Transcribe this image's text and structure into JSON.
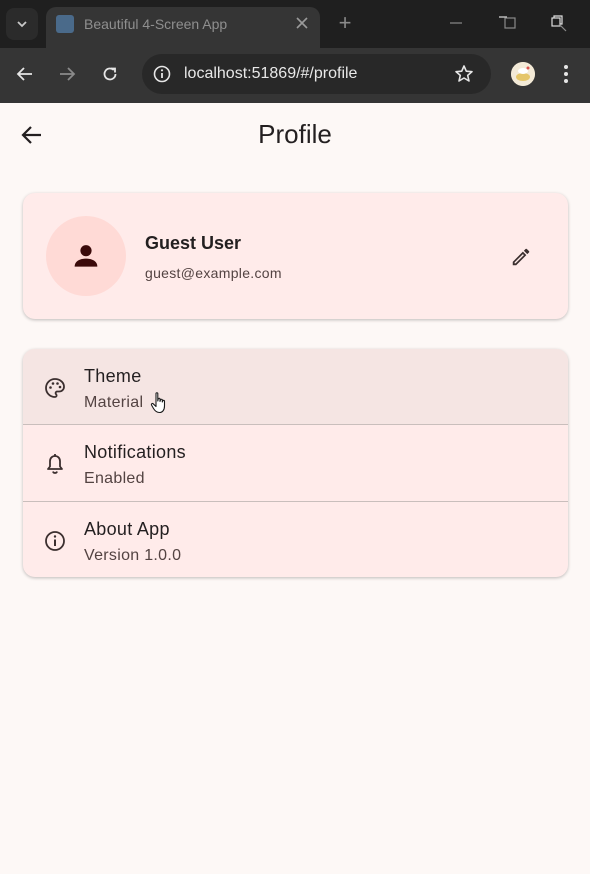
{
  "browser": {
    "tab_title": "Beautiful 4-Screen App",
    "tab_close_icon": "close-icon",
    "new_tab_label": "+",
    "url": "localhost:51869/#/profile"
  },
  "app": {
    "title": "Profile",
    "colors": {
      "background": "#fdf8f6",
      "card": "#ffebea",
      "avatar_bg": "#ffdad6",
      "primary_text": "#231f20",
      "secondary_text": "#534342",
      "icon": "#3b1414"
    }
  },
  "profile": {
    "name": "Guest User",
    "email": "guest@example.com",
    "avatar_icon": "person-icon",
    "edit_icon": "pencil-icon"
  },
  "settings": [
    {
      "title": "Theme",
      "subtitle": "Material",
      "icon": "palette-icon"
    },
    {
      "title": "Notifications",
      "subtitle": "Enabled",
      "icon": "bell-icon"
    },
    {
      "title": "About App",
      "subtitle": "Version 1.0.0",
      "icon": "info-icon"
    }
  ]
}
